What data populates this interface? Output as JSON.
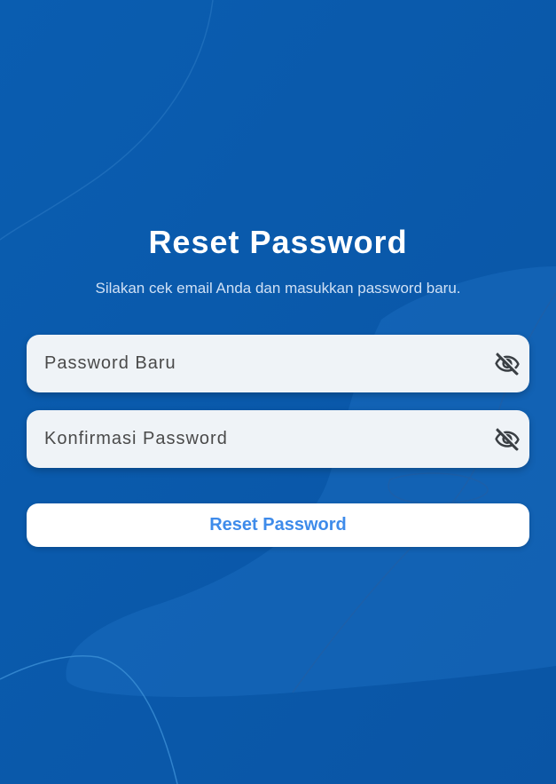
{
  "page": {
    "title": "Reset Password",
    "subtitle": "Silakan cek email Anda dan masukkan password baru."
  },
  "form": {
    "new_password": {
      "placeholder": "Password Baru",
      "value": "",
      "icon": "eye-off-icon"
    },
    "confirm_password": {
      "placeholder": "Konfirmasi Password",
      "value": "",
      "icon": "eye-off-icon"
    },
    "submit_label": "Reset Password"
  },
  "colors": {
    "background": "#0b59aa",
    "field_background": "#eff3f7",
    "button_background": "#ffffff",
    "button_text": "#3e8bea",
    "title_text": "#ffffff",
    "subtitle_text": "#cfe0f5"
  }
}
